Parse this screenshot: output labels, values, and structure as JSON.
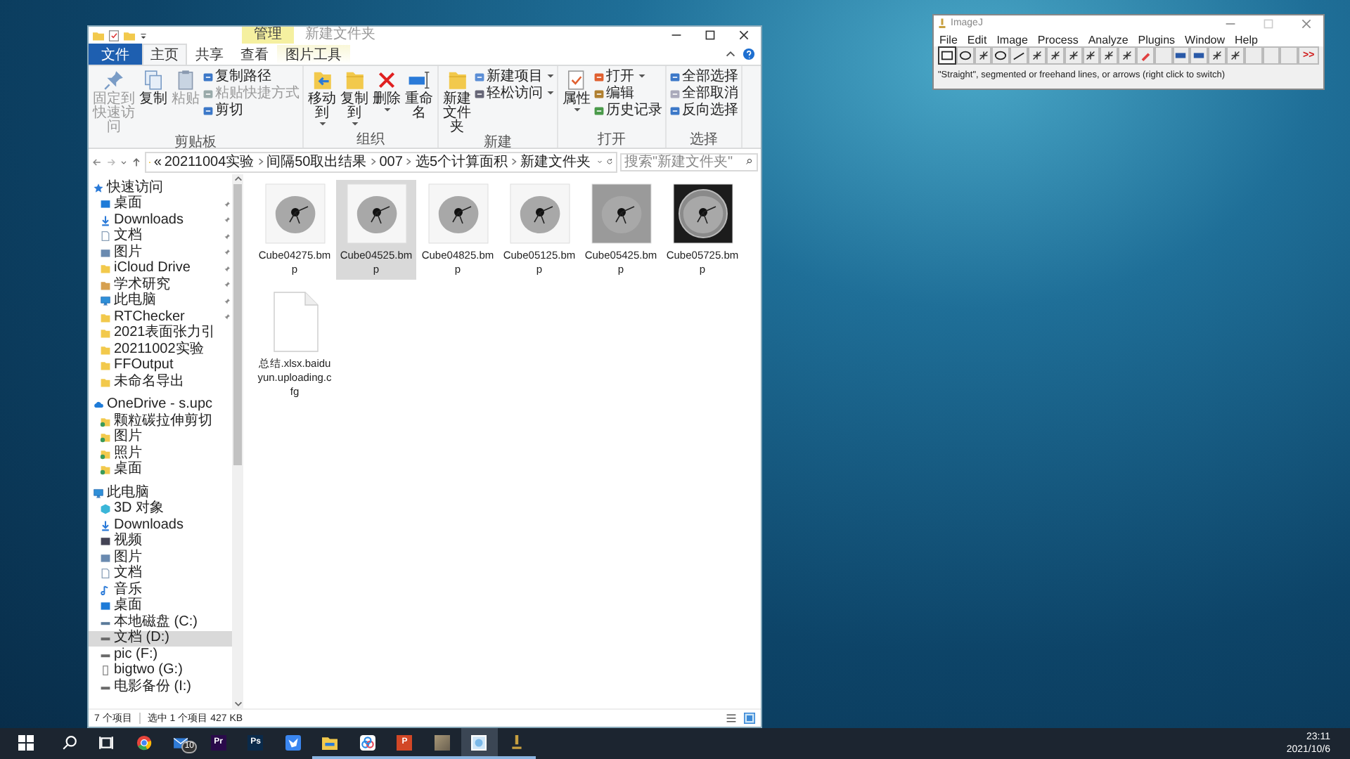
{
  "explorer": {
    "title_bar": {
      "context_tab": "管理",
      "title": "新建文件夹"
    },
    "tabs": [
      {
        "label": "文件",
        "kind": "file",
        "selected": false
      },
      {
        "label": "主页",
        "kind": "tab",
        "selected": true
      },
      {
        "label": "共享",
        "kind": "tab",
        "selected": false
      },
      {
        "label": "查看",
        "kind": "tab",
        "selected": false
      },
      {
        "label": "图片工具",
        "kind": "context",
        "selected": false
      }
    ],
    "ribbon": [
      {
        "label": "剪贴板",
        "large": [
          {
            "label": "固定到快速访问",
            "disabled": true,
            "dropdown": false
          },
          {
            "label": "复制",
            "disabled": false,
            "dropdown": false
          },
          {
            "label": "粘贴",
            "disabled": true,
            "dropdown": false
          }
        ],
        "small": [
          {
            "label": "复制路径",
            "disabled": false,
            "dropdown": false
          },
          {
            "label": "粘贴快捷方式",
            "disabled": true,
            "dropdown": false
          },
          {
            "label": "剪切",
            "disabled": false,
            "dropdown": false
          }
        ]
      },
      {
        "label": "组织",
        "large": [
          {
            "label": "移动到",
            "disabled": false,
            "dropdown": true
          },
          {
            "label": "复制到",
            "disabled": false,
            "dropdown": true
          },
          {
            "label": "删除",
            "disabled": false,
            "dropdown": true
          },
          {
            "label": "重命名",
            "disabled": false,
            "dropdown": false
          }
        ]
      },
      {
        "label": "新建",
        "large": [
          {
            "label": "新建文件夹",
            "disabled": false,
            "dropdown": false
          }
        ],
        "small": [
          {
            "label": "新建项目",
            "disabled": false,
            "dropdown": true
          },
          {
            "label": "轻松访问",
            "disabled": false,
            "dropdown": true
          }
        ]
      },
      {
        "label": "打开",
        "large": [
          {
            "label": "属性",
            "disabled": false,
            "dropdown": true
          }
        ],
        "small": [
          {
            "label": "打开",
            "disabled": false,
            "dropdown": true
          },
          {
            "label": "编辑",
            "disabled": false,
            "dropdown": false
          },
          {
            "label": "历史记录",
            "disabled": false,
            "dropdown": false
          }
        ]
      },
      {
        "label": "选择",
        "small": [
          {
            "label": "全部选择",
            "disabled": false,
            "dropdown": false
          },
          {
            "label": "全部取消",
            "disabled": false,
            "dropdown": false
          },
          {
            "label": "反向选择",
            "disabled": false,
            "dropdown": false
          }
        ]
      }
    ],
    "address": {
      "path": [
        "«",
        "20211004实验",
        "间隔50取出结果",
        "007",
        "选5个计算面积",
        "新建文件夹"
      ],
      "search": {
        "placeholder": "搜索\"新建文件夹\""
      }
    },
    "sidebar": [
      {
        "label": "快速访问",
        "kind": "star",
        "selected": false,
        "children": [
          {
            "label": "桌面",
            "kind": "desktop",
            "selected": false,
            "pinned": true
          },
          {
            "label": "Downloads",
            "kind": "download",
            "selected": false,
            "pinned": true
          },
          {
            "label": "文档",
            "kind": "document",
            "selected": false,
            "pinned": true
          },
          {
            "label": "图片",
            "kind": "pictures",
            "selected": false,
            "pinned": true
          },
          {
            "label": "iCloud Drive",
            "kind": "folder",
            "selected": false,
            "pinned": true
          },
          {
            "label": "学术研究",
            "kind": "research",
            "selected": false,
            "pinned": true
          },
          {
            "label": "此电脑",
            "kind": "computer",
            "selected": false,
            "pinned": true
          },
          {
            "label": "RTChecker",
            "kind": "folder",
            "selected": false,
            "pinned": true
          },
          {
            "label": "2021表面张力引",
            "kind": "folder",
            "selected": false,
            "pinned": false
          },
          {
            "label": "20211002实验",
            "kind": "folder",
            "selected": false,
            "pinned": false
          },
          {
            "label": "FFOutput",
            "kind": "folder",
            "selected": false,
            "pinned": false
          },
          {
            "label": "未命名导出",
            "kind": "folder",
            "selected": false,
            "pinned": false
          }
        ]
      },
      {
        "label": "OneDrive - s.upc",
        "kind": "cloud",
        "selected": false,
        "children": [
          {
            "label": "颗粒碳拉伸剪切",
            "kind": "synced",
            "selected": false
          },
          {
            "label": "图片",
            "kind": "synced",
            "selected": false
          },
          {
            "label": "照片",
            "kind": "synced",
            "selected": false
          },
          {
            "label": "桌面",
            "kind": "synced",
            "selected": false
          }
        ]
      },
      {
        "label": "此电脑",
        "kind": "computer",
        "selected": false,
        "children": [
          {
            "label": "3D 对象",
            "kind": "object3d",
            "selected": false
          },
          {
            "label": "Downloads",
            "kind": "download",
            "selected": false
          },
          {
            "label": "视频",
            "kind": "video",
            "selected": false
          },
          {
            "label": "图片",
            "kind": "pictures",
            "selected": false
          },
          {
            "label": "文档",
            "kind": "document",
            "selected": false
          },
          {
            "label": "音乐",
            "kind": "music",
            "selected": false
          },
          {
            "label": "桌面",
            "kind": "desktop",
            "selected": false
          },
          {
            "label": "本地磁盘 (C:)",
            "kind": "system_drive",
            "selected": false
          },
          {
            "label": "文档 (D:)",
            "kind": "drive",
            "selected": true
          },
          {
            "label": "pic (F:)",
            "kind": "drive",
            "selected": false
          },
          {
            "label": "bigtwo (G:)",
            "kind": "usb",
            "selected": false
          },
          {
            "label": "电影备份 (I:)",
            "kind": "drive",
            "selected": false
          }
        ]
      }
    ],
    "files": [
      {
        "name": "Cube04275.bmp",
        "kind": "image",
        "selected": false
      },
      {
        "name": "Cube04525.bmp",
        "kind": "image",
        "selected": true
      },
      {
        "name": "Cube04825.bmp",
        "kind": "image",
        "selected": false
      },
      {
        "name": "Cube05125.bmp",
        "kind": "image",
        "selected": false
      },
      {
        "name": "Cube05425.bmp",
        "kind": "image",
        "selected": false
      },
      {
        "name": "Cube05725.bmp",
        "kind": "image",
        "selected": false
      },
      {
        "name": "总结.xlsx.baiduyun.uploading.cfg",
        "kind": "file",
        "selected": false
      }
    ],
    "status_bar": {
      "count": "7 个项目",
      "selection": "选中 1 个项目  427 KB"
    }
  },
  "imagej": {
    "title": "ImageJ",
    "menus": [
      "File",
      "Edit",
      "Image",
      "Process",
      "Analyze",
      "Plugins",
      "Window",
      "Help"
    ],
    "tools": [
      {
        "selected": true
      },
      {
        "selected": false
      },
      {
        "selected": false
      },
      {
        "selected": false
      },
      {
        "selected": false
      },
      {
        "selected": false
      },
      {
        "selected": false
      },
      {
        "selected": false
      },
      {
        "selected": false
      },
      {
        "selected": false
      },
      {
        "selected": false
      },
      {
        "selected": false
      },
      {
        "selected": false
      },
      {
        "selected": false
      },
      {
        "selected": false
      },
      {
        "selected": false
      },
      {
        "selected": false
      },
      {
        "selected": false
      },
      {
        "selected": false
      },
      {
        "selected": false
      }
    ],
    "more_label": ">>",
    "status": "\"Straight\", segmented or freehand lines, or arrows (right click to switch)"
  },
  "taskbar": {
    "items": [
      {
        "kind": "start",
        "running": false,
        "active": false
      },
      {
        "kind": "search",
        "running": false,
        "active": false
      },
      {
        "kind": "taskview",
        "running": false,
        "active": false
      },
      {
        "kind": "chrome",
        "running": false,
        "active": false
      },
      {
        "kind": "mail",
        "badge": "10",
        "running": false,
        "active": false
      },
      {
        "kind": "premiere",
        "label": "Pr",
        "running": false,
        "active": false
      },
      {
        "kind": "photoshop",
        "label": "Ps",
        "running": false,
        "active": false
      },
      {
        "kind": "bird",
        "running": false,
        "active": false
      },
      {
        "kind": "explorer",
        "running": true,
        "active": false
      },
      {
        "kind": "netdisk",
        "running": true,
        "active": false
      },
      {
        "kind": "powerpoint",
        "label": "P",
        "running": true,
        "active": false
      },
      {
        "kind": "photo",
        "running": true,
        "active": false
      },
      {
        "kind": "viewer",
        "running": true,
        "active": true
      },
      {
        "kind": "microscope",
        "running": true,
        "active": false
      }
    ],
    "time": "23:11",
    "date": "2021/10/6"
  }
}
